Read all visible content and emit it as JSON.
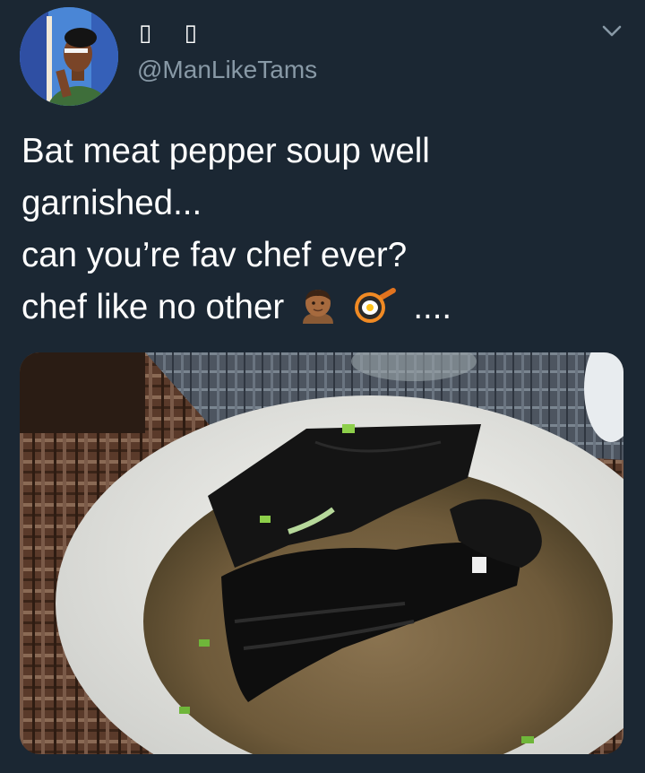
{
  "tweet": {
    "display_name": "▯ ▯",
    "handle": "@ManLikeTams",
    "lines": [
      "Bat meat pepper soup well",
      "garnished...",
      "can you’re fav chef ever?",
      "chef like no other"
    ],
    "trailing": "...."
  },
  "icons": {
    "menu": "chevron-down-icon",
    "emoji_1": "man-medium-dark-skin-emoji",
    "emoji_2": "frying-pan-egg-emoji"
  },
  "colors": {
    "background": "#1b2733",
    "text": "#ffffff",
    "secondary_text": "#8899a6"
  }
}
